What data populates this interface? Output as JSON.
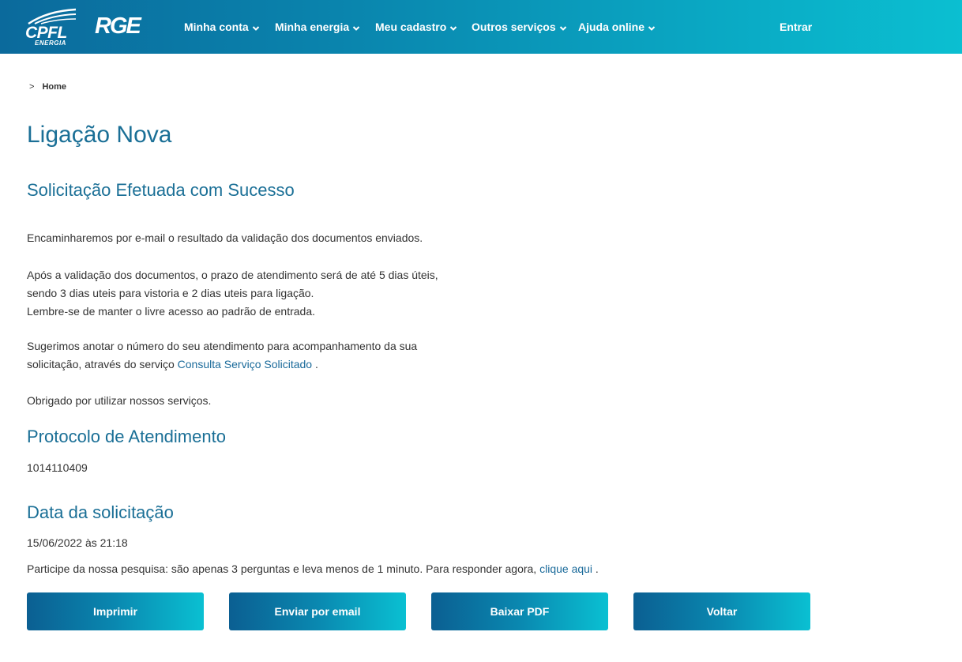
{
  "header": {
    "logo_cpfl": "CPFL",
    "logo_cpfl_sub": "ENERGIA",
    "logo_rge": "RGE",
    "nav": [
      {
        "label": "Minha conta"
      },
      {
        "label": "Minha energia"
      },
      {
        "label": "Meu cadastro"
      },
      {
        "label": "Outros serviços"
      },
      {
        "label": "Ajuda online"
      }
    ],
    "login_label": "Entrar",
    "gradient_start": "#0b6a9c",
    "gradient_end": "#0bbfd1"
  },
  "breadcrumb": {
    "separator": ">",
    "home": "Home"
  },
  "main": {
    "title": "Ligação Nova",
    "success_title": "Solicitação Efetuada com Sucesso",
    "p1": "Encaminharemos por e-mail o resultado da validação dos documentos enviados.",
    "p2_line1": "Após a validação dos documentos, o prazo de atendimento será de até 5 dias úteis,",
    "p2_line2": "sendo 3 dias uteis para vistoria e 2 dias uteis para ligação.",
    "p2_line3": "Lembre-se de manter o livre acesso ao padrão de entrada.",
    "p3_line1": "Sugerimos anotar o número do seu atendimento para acompanhamento da sua",
    "p3_line2_prefix": "solicitação, através do serviço",
    "p3_link": "Consulta Serviço Solicitado",
    "p3_suffix": ".",
    "p4": "Obrigado por utilizar nossos serviços.",
    "protocol_title": "Protocolo de Atendimento",
    "protocol_value": "1014110409",
    "date_title": "Data da solicitação",
    "date_value": "15/06/2022 às 21:18",
    "survey_text": "Participe da nossa pesquisa: são apenas 3 perguntas e leva menos de 1 minuto. Para responder agora,",
    "survey_link": "clique aqui",
    "survey_suffix": "."
  },
  "buttons": {
    "print": "Imprimir",
    "email": "Enviar por email",
    "pdf": "Baixar PDF",
    "back": "Voltar"
  },
  "colors": {
    "heading": "#1a6f96",
    "link": "#1a6a9a",
    "button_start": "#0b5f92",
    "button_end": "#0ac0d2"
  }
}
